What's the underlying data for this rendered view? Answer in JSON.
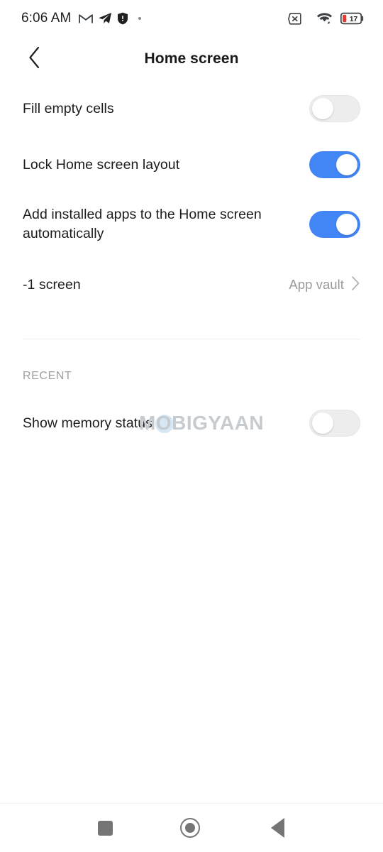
{
  "status_bar": {
    "clock": "6:06 AM",
    "left_icons": [
      "gmail-icon",
      "telegram-icon",
      "shield-icon",
      "notification-dot"
    ],
    "right_icons": [
      "no-sim-icon",
      "wifi-icon",
      "battery-icon"
    ],
    "battery_level": "17",
    "battery_color": "#e53935"
  },
  "header": {
    "back_icon": "chevron-left-icon",
    "title": "Home screen"
  },
  "settings": {
    "rows": [
      {
        "label": "Fill empty cells",
        "control": "toggle",
        "state": "off"
      },
      {
        "label": "Lock Home screen layout",
        "control": "toggle",
        "state": "on"
      },
      {
        "label": "Add installed apps to the Home screen automatically",
        "control": "toggle",
        "state": "on"
      },
      {
        "label": "-1 screen",
        "control": "value",
        "value": "App vault",
        "chevron": "chevron-right-icon"
      }
    ],
    "section_recent": {
      "header": "RECENT",
      "rows": [
        {
          "label": "Show memory status",
          "control": "toggle",
          "state": "off"
        }
      ]
    }
  },
  "watermark": {
    "text_before": "M",
    "text_ring": "O",
    "text_after": "BIGYAAN",
    "full": "MOBIGYAAN"
  },
  "nav_bar": {
    "recents_icon": "square-recents-icon",
    "home_icon": "circle-home-icon",
    "back_icon": "triangle-back-icon"
  },
  "colors": {
    "toggle_on": "#4285f4",
    "toggle_off_track": "#ededed",
    "text_primary": "#1c1c1c",
    "text_secondary": "#9a9a9a",
    "nav_icon": "#757575"
  }
}
